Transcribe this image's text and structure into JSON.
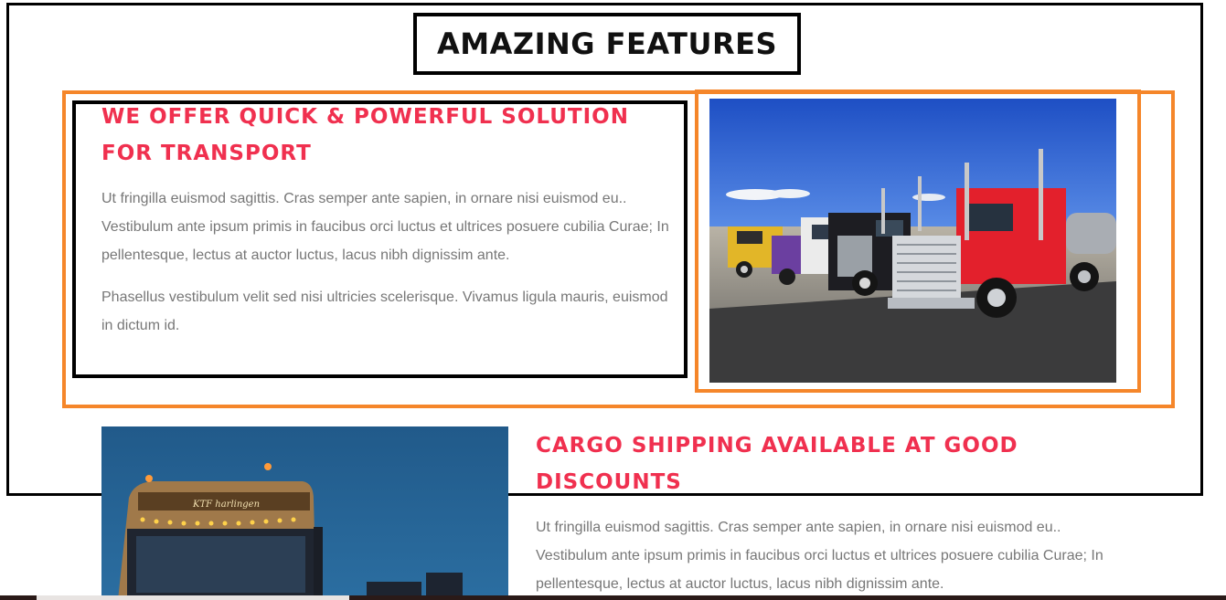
{
  "section": {
    "title": "AMAZING FEATURES"
  },
  "feature1": {
    "title": "WE OFFER QUICK & POWERFUL SOLUTION FOR TRANSPORT",
    "paragraphs": [
      "Ut fringilla euismod sagittis. Cras semper ante sapien, in ornare nisi euismod eu.. Vestibulum ante ipsum primis in faucibus orci luctus et ultrices posuere cubilia Curae; In pellentesque, lectus at auctor luctus, lacus nibh dignissim ante.",
      "Phasellus vestibulum velit sed nisi ultricies scelerisque. Vivamus ligula mauris, euismod in dictum id."
    ],
    "image_alt": "trucks-parked-photo"
  },
  "feature2": {
    "title": "CARGO SHIPPING AVAILABLE AT GOOD DISCOUNTS",
    "paragraphs": [
      "Ut fringilla euismod sagittis. Cras semper ante sapien, in ornare nisi euismod eu.. Vestibulum ante ipsum primis in faucibus orci luctus et ultrices posuere cubilia Curae; In pellentesque, lectus at auctor luctus, lacus nibh dignissim ante."
    ],
    "truck_sign": "KTF harlingen",
    "image_alt": "night-truck-photo"
  },
  "colors": {
    "accent": "#f0304f",
    "highlight_orange": "#f5862a",
    "outline_black": "#000000",
    "body_text": "#777777"
  }
}
